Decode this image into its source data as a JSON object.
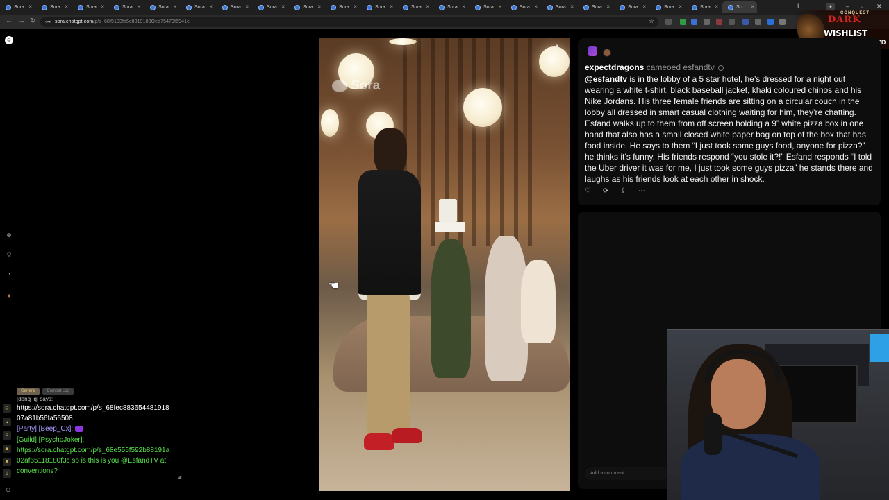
{
  "browser": {
    "tab_title": "Sora",
    "tab_count": 21,
    "active_tab_title": "Sc",
    "url_host": "sora.chatgpt.com",
    "url_path": "/p/s_68f5133fa5c8819188Oed75479f6941e",
    "new_tab": "+"
  },
  "overlay": {
    "conquest": "CONQUEST",
    "brand": "DARK",
    "wishlist": "WISHLIST NOW",
    "link": "OTK.TO/CD"
  },
  "sora": {
    "logo": "☺",
    "watermark": "Sora"
  },
  "post": {
    "username": "expectdragons",
    "action": "cameoed esfandtv",
    "mention": "@esfandtv",
    "caption": " is in the lobby of a 5 star hotel, he’s dressed for a night out wearing a white t-shirt, black baseball jacket, khaki coloured chinos and his Nike Jordans. His three female friends are sitting on a circular couch in the lobby all dressed in smart casual clothing waiting for him, they’re chatting. Esfand walks up to them from off screen holding a 9” white pizza box in one hand that also has a small closed white paper bag on top of the box that has food inside. He says to them “I just took some guys food, anyone for pizza?” he thinks it’s funny. His friends respond “you stole it?!” Esfand responds “I told the Uber driver it was for me, I just took some guys pizza” he stands there and laughs as his friends look at each other in shock.",
    "comment_placeholder": "Add a comment..."
  },
  "chat": {
    "tabs": [
      "General",
      "Combat Log"
    ],
    "line0": "[denq_q] says:",
    "line1": "https://sora.chatgpt.com/p/s_68fec883654481918",
    "line2": "07a81b56fa56508",
    "party_prefix": "[Party] [Beep_Cx]:",
    "guild_prefix": "[Guild] [PsychoJoker]:",
    "line5": "https://sora.chatgpt.com/p/s_68e555f592b88191a",
    "line6": "02af65118180f3c so is this is you @EsfandTV at",
    "line7": "conventions?"
  },
  "colors": {
    "accent_blue": "#3a78d8",
    "party": "#a89cff",
    "guild": "#58e14c",
    "brand_red": "#d2271f"
  },
  "icons": {
    "rail": [
      "plus-circle-icon",
      "search-icon",
      "bell-icon",
      "avatar-icon"
    ],
    "post_actions": [
      "heart-icon",
      "remix-icon",
      "share-icon",
      "more-icon"
    ],
    "video": [
      "speaker-muted-icon"
    ]
  }
}
